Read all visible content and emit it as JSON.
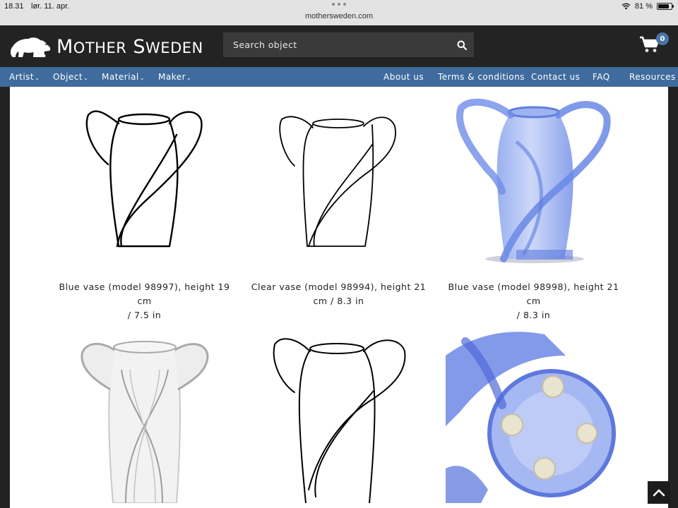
{
  "status_bar": {
    "time": "18.31",
    "date": "lør. 11. apr.",
    "url": "mothersweden.com",
    "battery": "81 %",
    "battery_level": 0.81
  },
  "header": {
    "logo_text": "Mother Sweden",
    "search_placeholder": "Search object",
    "cart_count": "0"
  },
  "nav": {
    "left": [
      {
        "label": "Artist"
      },
      {
        "label": "Object"
      },
      {
        "label": "Material"
      },
      {
        "label": "Maker"
      }
    ],
    "right": [
      {
        "label": "About us"
      },
      {
        "label": "Terms & conditions"
      },
      {
        "label": "Contact us"
      },
      {
        "label": "FAQ"
      },
      {
        "label": "Resources"
      }
    ]
  },
  "products": [
    {
      "caption_1": "Blue vase (model 98997), height 19 cm",
      "caption_2": "/ 7.5 in"
    },
    {
      "caption_1": "Clear vase (model 98994), height 21",
      "caption_2": "cm / 8.3 in"
    },
    {
      "caption_1": "Blue vase (model 98998), height 21 cm",
      "caption_2": "/ 8.3 in"
    }
  ],
  "colors": {
    "nav_blue": "#3f6b9d",
    "header_bg": "#232323",
    "page_bg": "#222222"
  }
}
